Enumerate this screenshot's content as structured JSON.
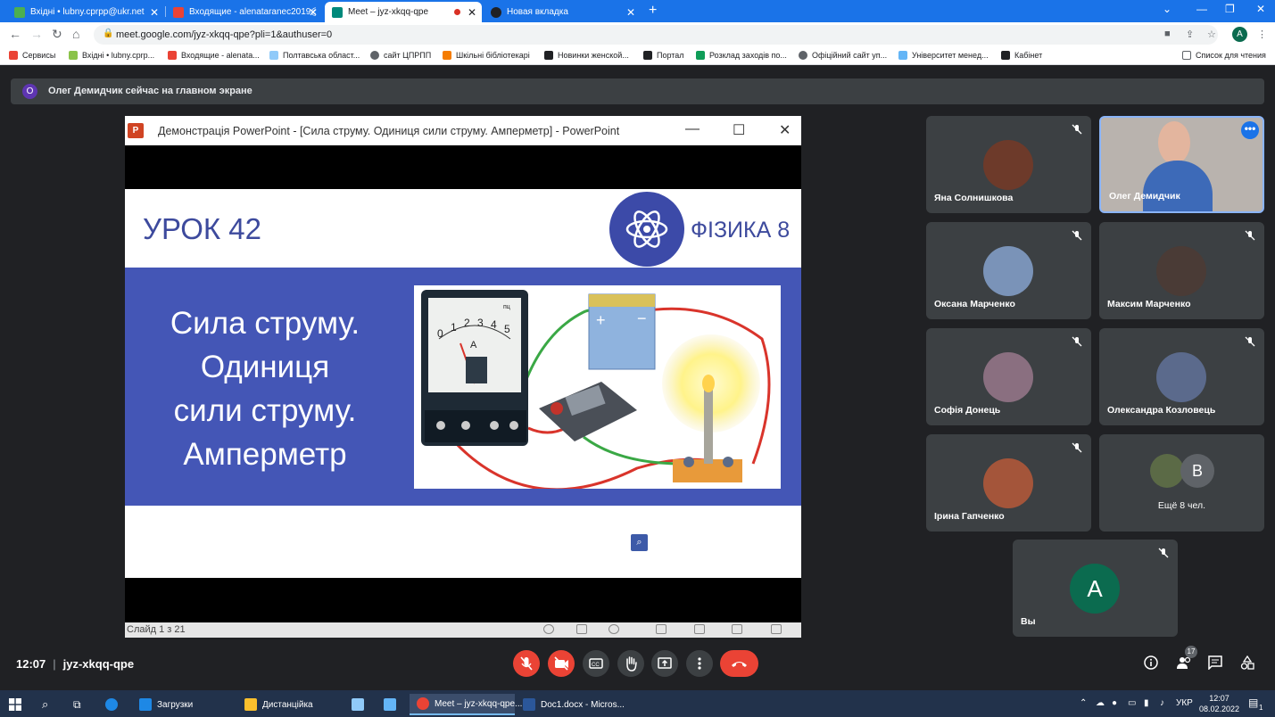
{
  "browser": {
    "tabs": [
      {
        "title": "Вхідні • lubny.cprpp@ukr.net",
        "color": "#4caf50"
      },
      {
        "title": "Входящие - alenataranec2019@",
        "color": "#ea4335"
      },
      {
        "title": "Meet – jyz-xkqq-qpe",
        "color": "#00897b"
      },
      {
        "title": "Новая вкладка",
        "color": "#202124"
      }
    ],
    "new_tab_label": "+",
    "url": "meet.google.com/jyz-xkqq-qpe?pli=1&authuser=0",
    "profile_initial": "A",
    "bookmarks": [
      {
        "label": "Сервисы",
        "color": "#ea4335"
      },
      {
        "label": "Вхідні • lubny.cprp...",
        "color": "#8bc34a"
      },
      {
        "label": "Входящие - alenata...",
        "color": "#ea4335"
      },
      {
        "label": "Полтавська област...",
        "color": "#90caf9"
      },
      {
        "label": "сайт ЦПРПП",
        "color": "#5f6368"
      },
      {
        "label": "Шкільні бібліотекарі",
        "color": "#f57c00"
      },
      {
        "label": "Новинки женской...",
        "color": "#202124"
      },
      {
        "label": "Портал",
        "color": "#202124"
      },
      {
        "label": "Розклад заходів по...",
        "color": "#0f9d58"
      },
      {
        "label": "Офіційний сайт уп...",
        "color": "#5f6368"
      },
      {
        "label": "Університет менед...",
        "color": "#64b5f6"
      },
      {
        "label": "Кабінет",
        "color": "#202124"
      }
    ],
    "reading_list": "Список для чтения"
  },
  "meet": {
    "banner_initial": "О",
    "banner_text": "Олег Демидчик сейчас на главном экране",
    "presentation": {
      "window_title": "Демонстрація PowerPoint - [Сила струму. Одиниця сили струму. Амперметр] - PowerPoint",
      "ppt_icon": "P",
      "lesson": "УРОК 42",
      "subject": "ФІЗИКА 8",
      "heading_lines": [
        "Сила струму.",
        "Одиниця",
        "сили струму.",
        "Амперметр"
      ],
      "ammeter_scale": [
        "0",
        "1",
        "2",
        "3",
        "4",
        "5"
      ],
      "ammeter_unit": "A",
      "ammeter_corner": "пц",
      "slide_status": "Слайд 1 з 21"
    },
    "participants": [
      {
        "name": "Яна Солнишкова",
        "avatar_color": "#6d3a2a"
      },
      {
        "name": "Олег Демидчик",
        "video": true,
        "more": "•••"
      },
      {
        "name": "Оксана Марченко",
        "avatar_color": "#7a93b8"
      },
      {
        "name": "Максим Марченко",
        "avatar_color": "#4a3b36"
      },
      {
        "name": "Софія Донець",
        "avatar_color": "#8a6f80"
      },
      {
        "name": "Олександра Козловець",
        "avatar_color": "#5b6a8c"
      },
      {
        "name": "Ірина Гапченко",
        "avatar_color": "#a4553a"
      }
    ],
    "more_tile": {
      "initial": "В",
      "count_text": "Ещё 8 чел."
    },
    "self_tile": {
      "initial": "A",
      "name": "Вы"
    },
    "time": "12:07",
    "meeting_code": "jyz-xkqq-qpe",
    "people_count": "17"
  },
  "taskbar": {
    "apps": [
      {
        "label": "Загрузки",
        "color": "#1e88e5"
      },
      {
        "label": "Дистанційка",
        "color": "#fbc02d"
      },
      {
        "label": "Meet – jyz-xkqq-qpe...",
        "color": "#ea4335",
        "active": true
      },
      {
        "label": "Doc1.docx - Micros...",
        "color": "#2b579a"
      }
    ],
    "lang": "УКР",
    "clock_time": "12:07",
    "clock_date": "08.02.2022",
    "notify_count": "1"
  }
}
